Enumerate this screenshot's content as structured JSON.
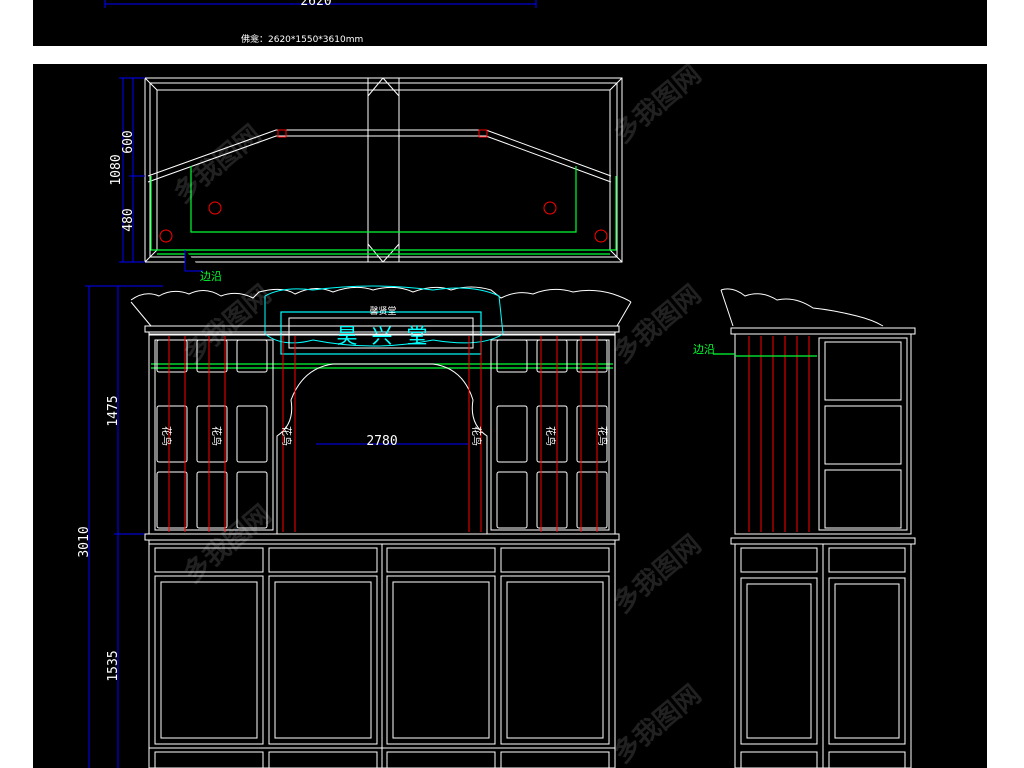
{
  "top_panel": {
    "dimension_top": "2620",
    "note": "佛龛：2620*1550*3610mm"
  },
  "plan_view": {
    "dim_600": "600",
    "dim_1080": "1080",
    "dim_480": "480",
    "edge_label": "边沿"
  },
  "front_elevation": {
    "plaque_header": "馨贤堂",
    "plaque_text": "昊兴堂",
    "dim_1475": "1475",
    "dim_3010": "3010",
    "dim_1535": "1535",
    "dim_2780": "2780",
    "panel_labels": [
      "花鸟",
      "花鸟",
      "花鸟",
      "花鸟",
      "花鸟",
      "花鸟"
    ]
  },
  "side_elevation": {
    "edge_label": "边沿"
  },
  "watermark": "多我图网",
  "colors": {
    "background": "#000000",
    "lines": "#ffffff",
    "dimension": "#0000ff",
    "plaque": "#00ffff",
    "guide": "#00ff33",
    "accent": "#ff0000"
  }
}
